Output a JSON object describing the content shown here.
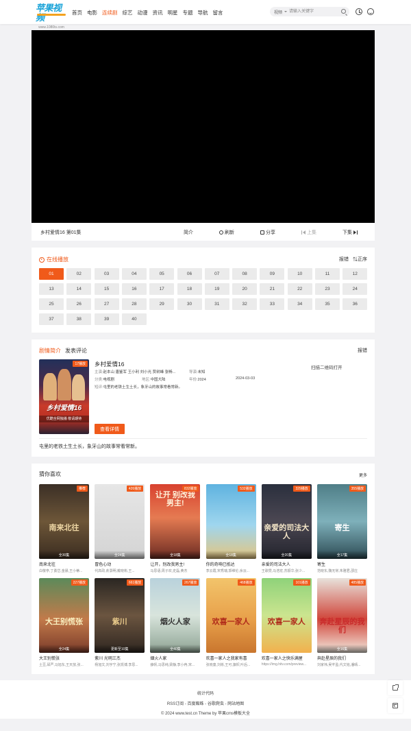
{
  "header": {
    "logo_text": "苹果视频",
    "logo_url": "www.1080ts.com",
    "nav": [
      "首页",
      "电影",
      "连续剧",
      "综艺",
      "动漫",
      "资讯",
      "明星",
      "专题",
      "导航",
      "留言"
    ],
    "nav_active_index": 2,
    "search_type": "视频",
    "search_placeholder": "请输入关键字"
  },
  "player": {
    "title": "乡村爱情16  第01集",
    "intro": "简介",
    "refresh": "刷新",
    "share": "分享",
    "prev": "上集",
    "next": "下集"
  },
  "episodes": {
    "section_title": "在线播放",
    "report": "报错",
    "order": "正序",
    "active_index": 0,
    "list": [
      "01",
      "02",
      "03",
      "04",
      "05",
      "06",
      "07",
      "08",
      "09",
      "10",
      "11",
      "12",
      "13",
      "14",
      "15",
      "16",
      "17",
      "18",
      "19",
      "20",
      "21",
      "22",
      "23",
      "24",
      "25",
      "26",
      "27",
      "28",
      "29",
      "30",
      "31",
      "32",
      "33",
      "34",
      "35",
      "36",
      "37",
      "38",
      "39",
      "40"
    ]
  },
  "intro": {
    "tab_intro": "剧情简介",
    "tab_comment": "发表评论",
    "report": "报错",
    "badge": "17播放",
    "poster_title": "乡村爱情16",
    "poster_sub": "优酷全网独播 敬请期待",
    "title": "乡村爱情16",
    "cast_key": "主演:",
    "cast": "赵本山 唐鉴军 王小利 刘小光 贾树峰 张畅...",
    "director_key": "导演:",
    "director": "未知",
    "category_key": "分类:",
    "category": "电视剧",
    "region_key": "地区:",
    "region": "中国大陆",
    "year_key": "年份:",
    "year": "2024",
    "date": "2024-03-03",
    "summary_key": "短评:",
    "summary": "屯里的老铁土生土长，象牙山的故事常看常新。",
    "qr_text": "扫描二维码打开",
    "detail_button": "查看详情",
    "description": "屯里的老铁土生土长，象牙山的故事常看常新。"
  },
  "guess": {
    "title": "猜你喜欢",
    "more": "更多",
    "items": [
      {
        "title": "南来北往",
        "sub": "白敬亭,丁勇岱,金晨,王小蒂...",
        "badge": "推荐",
        "overlay": "全30集",
        "cap": "南来北往",
        "bg": "linear-gradient(180deg,#3b2f26,#6d5638 50%,#3a2c20)",
        "capcolor": "#f0d9a6"
      },
      {
        "title": "冒色心动",
        "sub": "代高政,俞灏明,戴晓彬,王...",
        "badge": "426播放",
        "overlay": "全24集",
        "cap": "",
        "bg": "linear-gradient(180deg,#e6e6e6,#d4d4d4)",
        "capcolor": "#fff"
      },
      {
        "title": "让开，别改我男主!",
        "sub": "马思语,周子欢,史磊,黄杰",
        "badge": "832播放",
        "overlay": "全18集",
        "cap": "让开 别改我男主!",
        "bg": "linear-gradient(180deg,#d8412f,#e57b52 45%,#6b2b22)",
        "capcolor": "#fff3d9"
      },
      {
        "title": "你的奇响已抵达",
        "sub": "李云霞,宋秀瑞,郭维伦,余淡...",
        "badge": "532播放",
        "overlay": "全18集",
        "cap": "",
        "bg": "linear-gradient(180deg,#5fb3e0,#9fd6ee 55%,#e4c57f)",
        "capcolor": "#fff"
      },
      {
        "title": "亲爱的司法大人",
        "sub": "王歌霓,马浩宏,苏振华,张少...",
        "badge": "329播放",
        "overlay": "全20集",
        "cap": "亲爱的司法大人",
        "bg": "linear-gradient(180deg,#2a2f3d,#4b4752 50%,#22232c)",
        "capcolor": "#f5e6c8"
      },
      {
        "title": "寄生",
        "sub": "范晓东,魏无常,朱雅君,邵庄",
        "badge": "355播放",
        "overlay": "全17集",
        "cap": "寄生",
        "bg": "linear-gradient(180deg,#4f7e87,#7eb0ba 50%,#2d4b54)",
        "capcolor": "#ffffff"
      },
      {
        "title": "大王别慌张",
        "sub": "土豆,邱严,马旭东,王天放,张...",
        "badge": "227播放",
        "overlay": "全24集",
        "cap": "大王别慌张",
        "bg": "linear-gradient(180deg,#5c8a5a,#c27a4a 55%,#7a3b2a)",
        "capcolor": "#f9f0c0"
      },
      {
        "title": "紫川 光明三杰",
        "sub": "杨旭文,刘宇宁,张凯博,李思...",
        "badge": "661播放",
        "overlay": "更新至10集",
        "cap": "紫川",
        "bg": "linear-gradient(180deg,#2a2622,#6b5540 50%,#2f2620)",
        "capcolor": "#e8c98a"
      },
      {
        "title": "烟火人家",
        "sub": "薛帆,马思纯,梁静,李小冉,宋...",
        "badge": "267播放",
        "overlay": "全40集",
        "cap": "烟火人家",
        "bg": "linear-gradient(180deg,#b9d2dc,#d8e4dc 50%,#8ea393)",
        "capcolor": "#333"
      },
      {
        "title": "欢喜一家人之我家有喜",
        "sub": "张晓童,刘彬,王可,旗帜,叶后...",
        "badge": "468播放",
        "overlay": "",
        "cap": "欢喜一家人",
        "bg": "linear-gradient(180deg,#f2c46b,#e8a04a 55%,#c9762e)",
        "capcolor": "#b02a1a"
      },
      {
        "title": "欢喜一家人之快乐满屋",
        "sub": "https://img.hitv.com/preview...",
        "badge": "101播放",
        "overlay": "",
        "cap": "欢喜一家人",
        "bg": "linear-gradient(180deg,#8fd27a,#cbe58f 50%,#f2b14d)",
        "capcolor": "#b02a1a"
      },
      {
        "title": "奔赴星辰的我们",
        "sub": "刘家祎,吴芊盈,代文铭,潘晴...",
        "badge": "485播放",
        "overlay": "全16集",
        "cap": "奔赴星辰的我们",
        "bg": "linear-gradient(180deg,#e8e2db,#d0453a 55%,#f3ebe0)",
        "capcolor": "#c92a2a"
      }
    ]
  },
  "footer": {
    "stats": "统计代码",
    "links": "RSS订阅 - 百度蜘蛛 - 谷歌爬虫 - 网站地图",
    "copyright": "© 2024 www.test.cn Theme by 苹果cms模板大全"
  }
}
